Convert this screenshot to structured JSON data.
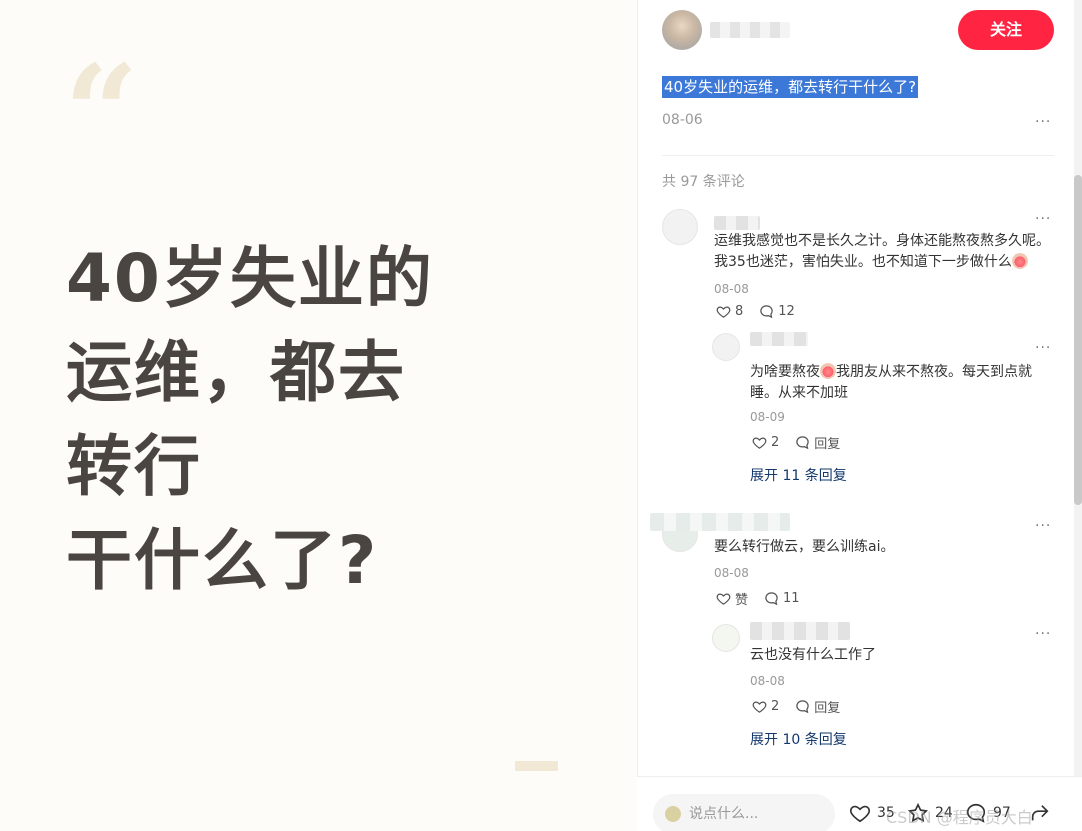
{
  "cover": {
    "title_line1": "40岁失业的",
    "title_line2_highlight": "运维",
    "title_line2_rest": "，都去",
    "title_line3": "转行",
    "title_line4": "干什么了?"
  },
  "post": {
    "follow_label": "关注",
    "title": "40岁失业的运维，都去转行干什么了?",
    "date": "08-06",
    "more": "···"
  },
  "comments": {
    "count_label": "共 97 条评论",
    "items": [
      {
        "text_part1": "运维我感觉也不是长久之计。身体还能熬夜熬多久呢。我35也迷茫，害怕失业。也不知道下一步做什么",
        "date": "08-08",
        "likes": "8",
        "replies": "12",
        "more": "···",
        "reply": {
          "text_part1": "为啥要熬夜",
          "text_part2": "我朋友从来不熬夜。每天到点就睡。从来不加班",
          "date": "08-09",
          "likes": "2",
          "reply_label": "回复",
          "more": "···"
        },
        "expand_label": "展开 11 条回复"
      },
      {
        "text": "要么转行做云，要么训练ai。",
        "date": "08-08",
        "like_label": "赞",
        "replies": "11",
        "more": "···",
        "reply": {
          "text": "云也没有什么工作了",
          "date": "08-08",
          "likes": "2",
          "reply_label": "回复",
          "more": "···"
        },
        "expand_label": "展开 10 条回复"
      }
    ]
  },
  "bottom_bar": {
    "input_placeholder": "说点什么...",
    "likes": "35",
    "collects": "24",
    "comments": "97",
    "watermark": "CSDN @程序员大白"
  },
  "colors": {
    "accent": "#ff2442",
    "highlight": "#b7f28a",
    "selection": "#3b78d8",
    "link": "#13386c"
  }
}
